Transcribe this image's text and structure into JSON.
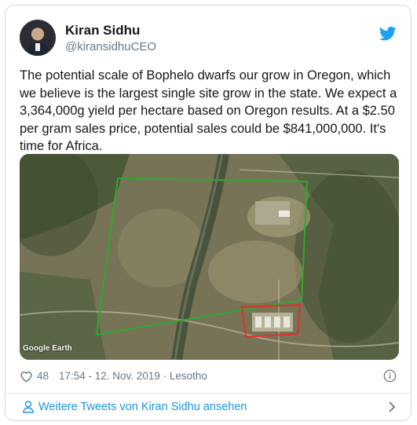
{
  "author": {
    "name": "Kiran Sidhu",
    "handle": "@kiransidhuCEO"
  },
  "tweet": {
    "text": "The potential scale of Bophelo dwarfs our grow in Oregon, which we believe is the largest single site grow in the state. We expect a 3,364,000g yield per hectare based on Oregon results. At a $2.50 per gram sales price, potential sales could be $841,000,000. It's time for Africa.",
    "image_attribution": "Google Earth",
    "likes": "48",
    "timestamp": "17:54 - 12. Nov. 2019 · Lesotho"
  },
  "footer": {
    "more_tweets": "Weitere Tweets von Kiran Sidhu ansehen"
  },
  "icons": [
    "twitter-bird-icon",
    "heart-icon",
    "info-icon",
    "user-icon",
    "chevron-right-icon"
  ],
  "colors": {
    "brand": "#1da1f2",
    "link": "#1b95e0",
    "muted": "#657786",
    "outline_large": "#2fa82f",
    "outline_small": "#e0302a"
  }
}
